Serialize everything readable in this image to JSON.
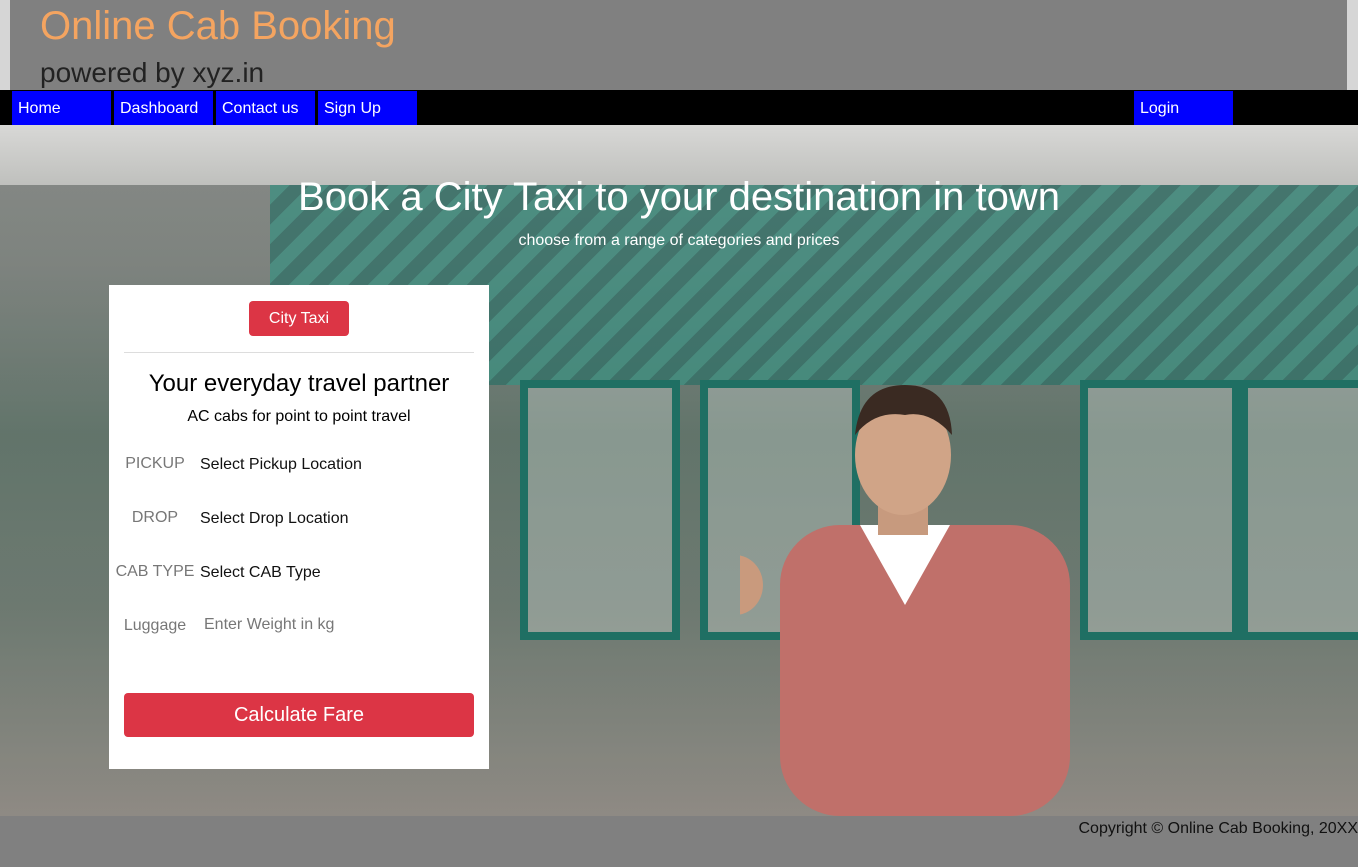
{
  "header": {
    "title": "Online Cab Booking",
    "subtitle": "powered by xyz.in"
  },
  "nav": {
    "home": "Home",
    "dashboard": "Dashboard",
    "contact": "Contact us",
    "signup": "Sign Up",
    "login": "Login"
  },
  "hero": {
    "heading": "Book a City Taxi to your destination in town",
    "subheading": "choose from a range of categories and prices"
  },
  "booking": {
    "tab_label": "City Taxi",
    "title": "Your everyday travel partner",
    "subtitle": "AC cabs for point to point travel",
    "pickup_label": "PICKUP",
    "pickup_value": "Select Pickup Location",
    "drop_label": "DROP",
    "drop_value": "Select Drop Location",
    "cab_type_label": "CAB TYPE",
    "cab_type_value": "Select CAB Type",
    "luggage_label": "Luggage",
    "luggage_placeholder": "Enter Weight in kg",
    "submit_label": "Calculate Fare"
  },
  "footer": {
    "copyright": "Copyright © Online Cab Booking, 20XX"
  },
  "colors": {
    "title": "#f4a460",
    "nav_button": "#0000ff",
    "primary_button": "#dc3545"
  }
}
